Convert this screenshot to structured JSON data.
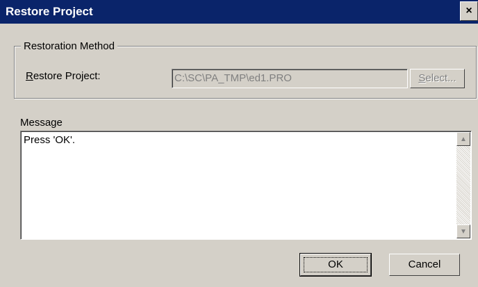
{
  "window": {
    "title": "Restore Project",
    "close_label": "×"
  },
  "restoration": {
    "group_title": "Restoration Method",
    "restore_label_underlined": "R",
    "restore_label_rest": "estore Project:",
    "path_value": "C:\\SC\\PA_TMP\\ed1.PRO",
    "select_underlined": "S",
    "select_rest": "elect..."
  },
  "message": {
    "label": "Message",
    "text": "Press 'OK'."
  },
  "buttons": {
    "ok": "OK",
    "cancel": "Cancel"
  },
  "icons": {
    "scroll_up": "▲",
    "scroll_down": "▼"
  }
}
